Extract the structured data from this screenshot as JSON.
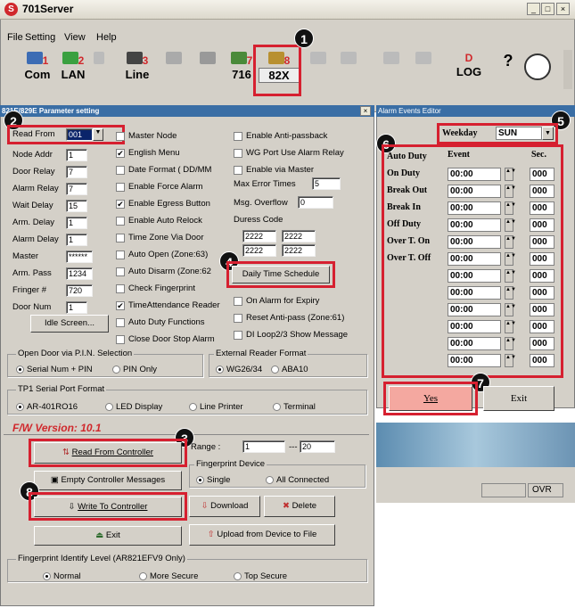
{
  "app": {
    "title": "701Server",
    "icon": "S"
  },
  "menu": [
    "File",
    "Setting",
    "View",
    "Help"
  ],
  "toolbar": [
    {
      "num": "1",
      "label": "Com"
    },
    {
      "num": "2",
      "label": "LAN"
    },
    {
      "num": "3",
      "label": "Line"
    },
    {
      "num": "7",
      "label": "716"
    },
    {
      "num": "8",
      "label": "82X"
    },
    {
      "num": "",
      "label": "LOG",
      "sup": "D"
    }
  ],
  "dialog": {
    "title": "821E/829E Parameter setting",
    "read_from_label": "Read From",
    "read_from_value": "001",
    "fields": [
      {
        "label": "Node Addr",
        "value": "1"
      },
      {
        "label": "Door Relay",
        "value": "7"
      },
      {
        "label": "Alarm Relay",
        "value": "7"
      },
      {
        "label": "Wait Delay",
        "value": "15"
      },
      {
        "label": "Arm. Delay",
        "value": "1"
      },
      {
        "label": "Alarm Delay",
        "value": "1"
      },
      {
        "label": "Master",
        "value": "******"
      },
      {
        "label": "Arm. Pass",
        "value": "1234"
      },
      {
        "label": "Fringer #",
        "value": "720"
      },
      {
        "label": "Door Num",
        "value": "1"
      }
    ],
    "mid_checks": [
      {
        "label": "Master Node",
        "checked": false
      },
      {
        "label": "English Menu",
        "checked": true
      },
      {
        "label": "Date Format ( DD/MM",
        "checked": false
      },
      {
        "label": "Enable Force Alarm",
        "checked": false
      },
      {
        "label": "Enable Egress Button",
        "checked": true
      },
      {
        "label": "Enable Auto Relock",
        "checked": false
      },
      {
        "label": "Time Zone Via Door",
        "checked": false
      },
      {
        "label": "Auto Open (Zone:63)",
        "checked": false
      },
      {
        "label": "Auto Disarm (Zone:62",
        "checked": false
      },
      {
        "label": "Check Fingerprint",
        "checked": false
      },
      {
        "label": "TimeAttendance Reader",
        "checked": true
      },
      {
        "label": "Auto Duty Functions",
        "checked": false
      },
      {
        "label": "Close Door Stop Alarm",
        "checked": false
      }
    ],
    "right_checks": [
      {
        "label": "Enable Anti-passback"
      },
      {
        "label": "WG Port Use Alarm Relay"
      },
      {
        "label": "Enable via Master"
      }
    ],
    "max_error_label": "Max Error Times",
    "max_error_value": "5",
    "msg_overflow_label": "Msg. Overflow",
    "msg_overflow_value": "0",
    "duress_label": "Duress Code",
    "duress_codes": [
      "2222",
      "2222",
      "2222",
      "2222"
    ],
    "daily_btn": "Daily Time Schedule",
    "right_checks2": [
      {
        "label": "On Alarm for Expiry"
      },
      {
        "label": "Reset Anti-pass (Zone:61)"
      },
      {
        "label": "DI Loop2/3 Show Message"
      }
    ],
    "idle_btn": "Idle Screen...",
    "open_door_title": "Open Door via P.I.N. Selection",
    "open_door_opts": [
      "Serial Num + PIN",
      "PIN Only"
    ],
    "ext_reader_title": "External Reader Format",
    "ext_reader_opts": [
      "WG26/34",
      "ABA10"
    ],
    "tp1_title": "TP1 Serial Port Format",
    "tp1_opts": [
      "AR-401RO16",
      "LED Display",
      "Line Printer",
      "Terminal"
    ],
    "fw": "F/W Version: 10.1",
    "read_ctrl_btn": "Read From Controller",
    "empty_btn": "Empty Controller Messages",
    "write_btn": "Write To Controller",
    "exit_btn": "Exit",
    "range_label": "Range :",
    "range_from": "1",
    "range_to": "20",
    "range_sep": "---",
    "fp_device_title": "Fingerprint Device",
    "fp_device_opts": [
      "Single",
      "All Connected"
    ],
    "download_btn": "Download",
    "delete_btn": "Delete",
    "upload_btn": "Upload from Device to File",
    "fp_level_title": "Fingerprint Identify Level (AR821EFV9 Only)",
    "fp_level_opts": [
      "Normal",
      "More Secure",
      "Top Secure"
    ]
  },
  "alarm": {
    "title": "Alarm Events Editor",
    "weekday_label": "Weekday",
    "weekday_value": "SUN",
    "headers": [
      "Auto Duty",
      "Event",
      "Sec."
    ],
    "rows": [
      {
        "label": "On Duty",
        "time": "00:00",
        "sec": "000"
      },
      {
        "label": "Break Out",
        "time": "00:00",
        "sec": "000"
      },
      {
        "label": "Break In",
        "time": "00:00",
        "sec": "000"
      },
      {
        "label": "Off Duty",
        "time": "00:00",
        "sec": "000"
      },
      {
        "label": "Over T. On",
        "time": "00:00",
        "sec": "000"
      },
      {
        "label": "Over T. Off",
        "time": "00:00",
        "sec": "000"
      },
      {
        "label": "",
        "time": "00:00",
        "sec": "000"
      },
      {
        "label": "",
        "time": "00:00",
        "sec": "000"
      },
      {
        "label": "",
        "time": "00:00",
        "sec": "000"
      },
      {
        "label": "",
        "time": "00:00",
        "sec": "000"
      },
      {
        "label": "",
        "time": "00:00",
        "sec": "000"
      },
      {
        "label": "",
        "time": "00:00",
        "sec": "000"
      }
    ],
    "yes_btn": "Yes",
    "exit_btn": "Exit"
  },
  "status": {
    "ovr": "OVR"
  },
  "badges": [
    "1",
    "2",
    "3",
    "4",
    "5",
    "6",
    "7",
    "8"
  ]
}
